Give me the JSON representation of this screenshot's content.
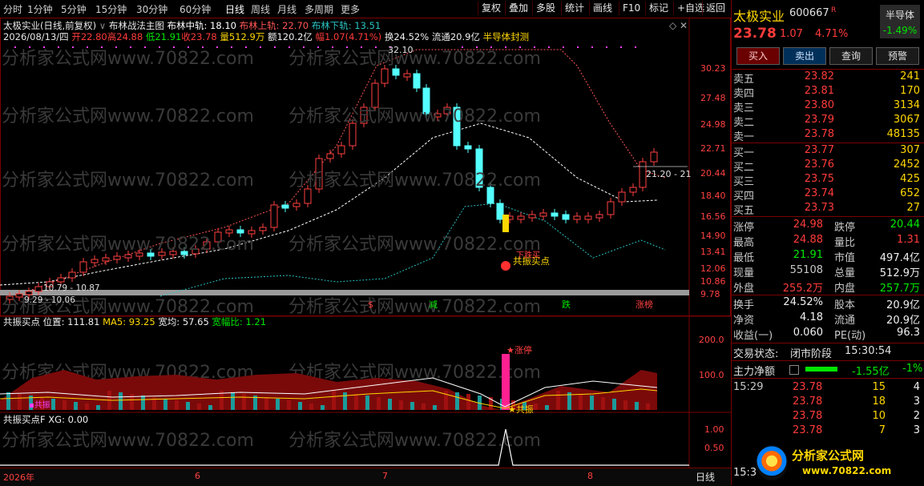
{
  "topbar": {
    "periods": [
      "分时",
      "1分钟",
      "5分钟",
      "15分钟",
      "30分钟",
      "60分钟",
      "日线",
      "周线",
      "月线",
      "多周期",
      "更多"
    ],
    "active_period": "日线",
    "tools": [
      "复权",
      "叠加",
      "多股",
      "统计",
      "画线",
      "F10",
      "标记",
      "+自选",
      "返回"
    ]
  },
  "main_panel": {
    "title_line": "太极实业(日线,前复权)",
    "indicator_name": "布林战法主图",
    "boll_mid_label": "布林中轨: 18.10",
    "boll_up_label": "布林上轨: 22.70",
    "boll_dn_label": "布林下轨: 13.51",
    "info": {
      "date": "2026/08/13/四",
      "open": "开22.80",
      "high": "高24.88",
      "low": "低21.91",
      "close": "收23.78",
      "volume": "量512.9万",
      "amount": "额120.2亿",
      "range": "幅1.07(4.71%)",
      "turnover": "换24.52%",
      "float": "流通20.9亿",
      "sector": "半导体封测"
    },
    "y_ticks": [
      "30.23",
      "27.48",
      "24.98",
      "22.71",
      "20.44",
      "18.40",
      "16.56",
      "14.90",
      "13.41",
      "12.06",
      "10.86",
      "9.78"
    ],
    "annotations": {
      "high_marker": "32.10",
      "price_tag": "21.20 - 21",
      "low_left_a": "10.79 - 10.87",
      "low_left_b": "9.29 - 10.06",
      "signal_buy": "共振买点",
      "signal_fall": "下跌买"
    },
    "event_tags": [
      "$",
      "减",
      "跌",
      "涨榜"
    ]
  },
  "panel2": {
    "name": "共振买点",
    "pos": "位置: 111.81",
    "ma5": "MA5: 93.25",
    "width_avg": "宽均: 57.65",
    "width_ratio": "宽幅比: 1.21",
    "y_ticks": [
      "200.0",
      "100.0"
    ],
    "tag_zt": "涨停",
    "tag_gz": "共振",
    "tag_left": "共振"
  },
  "panel3": {
    "name": "共振买点F",
    "xg": "XG: 0.00",
    "y_ticks": [
      "1.00",
      "0.50"
    ]
  },
  "time_axis": [
    "2026年",
    "6",
    "7",
    "8"
  ],
  "bottom_right_label": "日线",
  "watermark": "分析家公式网www.70822.com",
  "quote": {
    "name": "太极实业",
    "code": "600667",
    "r_flag": "R",
    "sector_tag": "半导体",
    "sector_pct": "-1.49%",
    "price": "23.78",
    "change": "1.07",
    "pct": "4.71%",
    "buttons": [
      "买入",
      "卖出",
      "查询",
      "预警"
    ],
    "asks": [
      {
        "label": "卖五",
        "price": "23.82",
        "vol": "241"
      },
      {
        "label": "卖四",
        "price": "23.81",
        "vol": "170"
      },
      {
        "label": "卖三",
        "price": "23.80",
        "vol": "3134"
      },
      {
        "label": "卖二",
        "price": "23.79",
        "vol": "3067"
      },
      {
        "label": "卖一",
        "price": "23.78",
        "vol": "48135"
      }
    ],
    "bids": [
      {
        "label": "买一",
        "price": "23.77",
        "vol": "307"
      },
      {
        "label": "买二",
        "price": "23.76",
        "vol": "2452"
      },
      {
        "label": "买三",
        "price": "23.75",
        "vol": "425"
      },
      {
        "label": "买四",
        "price": "23.74",
        "vol": "652"
      },
      {
        "label": "买五",
        "price": "23.73",
        "vol": "27"
      }
    ],
    "stats": [
      {
        "k1": "涨停",
        "v1": "24.98",
        "c1": "red",
        "k2": "跌停",
        "v2": "20.44",
        "c2": "grn"
      },
      {
        "k1": "最高",
        "v1": "24.88",
        "c1": "red",
        "k2": "量比",
        "v2": "1.31",
        "c2": "red"
      },
      {
        "k1": "最低",
        "v1": "21.91",
        "c1": "grn",
        "k2": "市值",
        "v2": "497.4亿",
        "c2": "wht"
      },
      {
        "k1": "现量",
        "v1": "55108",
        "c1": "mag",
        "k2": "总量",
        "v2": "512.9万",
        "c2": "wht"
      },
      {
        "k1": "外盘",
        "v1": "255.2万",
        "c1": "red",
        "k2": "内盘",
        "v2": "257.7万",
        "c2": "grn"
      }
    ],
    "stats2": [
      {
        "k1": "换手",
        "v1": "24.52%",
        "k2": "股本",
        "v2": "20.9亿"
      },
      {
        "k1": "净资",
        "v1": "4.18",
        "k2": "流通",
        "v2": "20.9亿"
      },
      {
        "k1": "收益(一)",
        "v1": "0.060",
        "k2": "PE(动)",
        "v2": "96.3"
      }
    ],
    "trade_state_label": "交易状态:",
    "trade_state": "闭市阶段",
    "trade_time": "15:30:54",
    "main_net_label": "主力净额",
    "main_net": "-1.55亿",
    "main_net_pct": "-1%",
    "ticks": [
      {
        "time": "15:29",
        "price": "23.78",
        "vol": "15",
        "n": "4"
      },
      {
        "time": "",
        "price": "23.78",
        "vol": "18",
        "n": "3"
      },
      {
        "time": "",
        "price": "23.78",
        "vol": "10",
        "n": "2"
      },
      {
        "time": "",
        "price": "23.78",
        "vol": "7",
        "n": "3"
      }
    ],
    "bottom_time": "15:3",
    "logo_text": "分析家公式网",
    "logo_url": "www.70822.com"
  }
}
